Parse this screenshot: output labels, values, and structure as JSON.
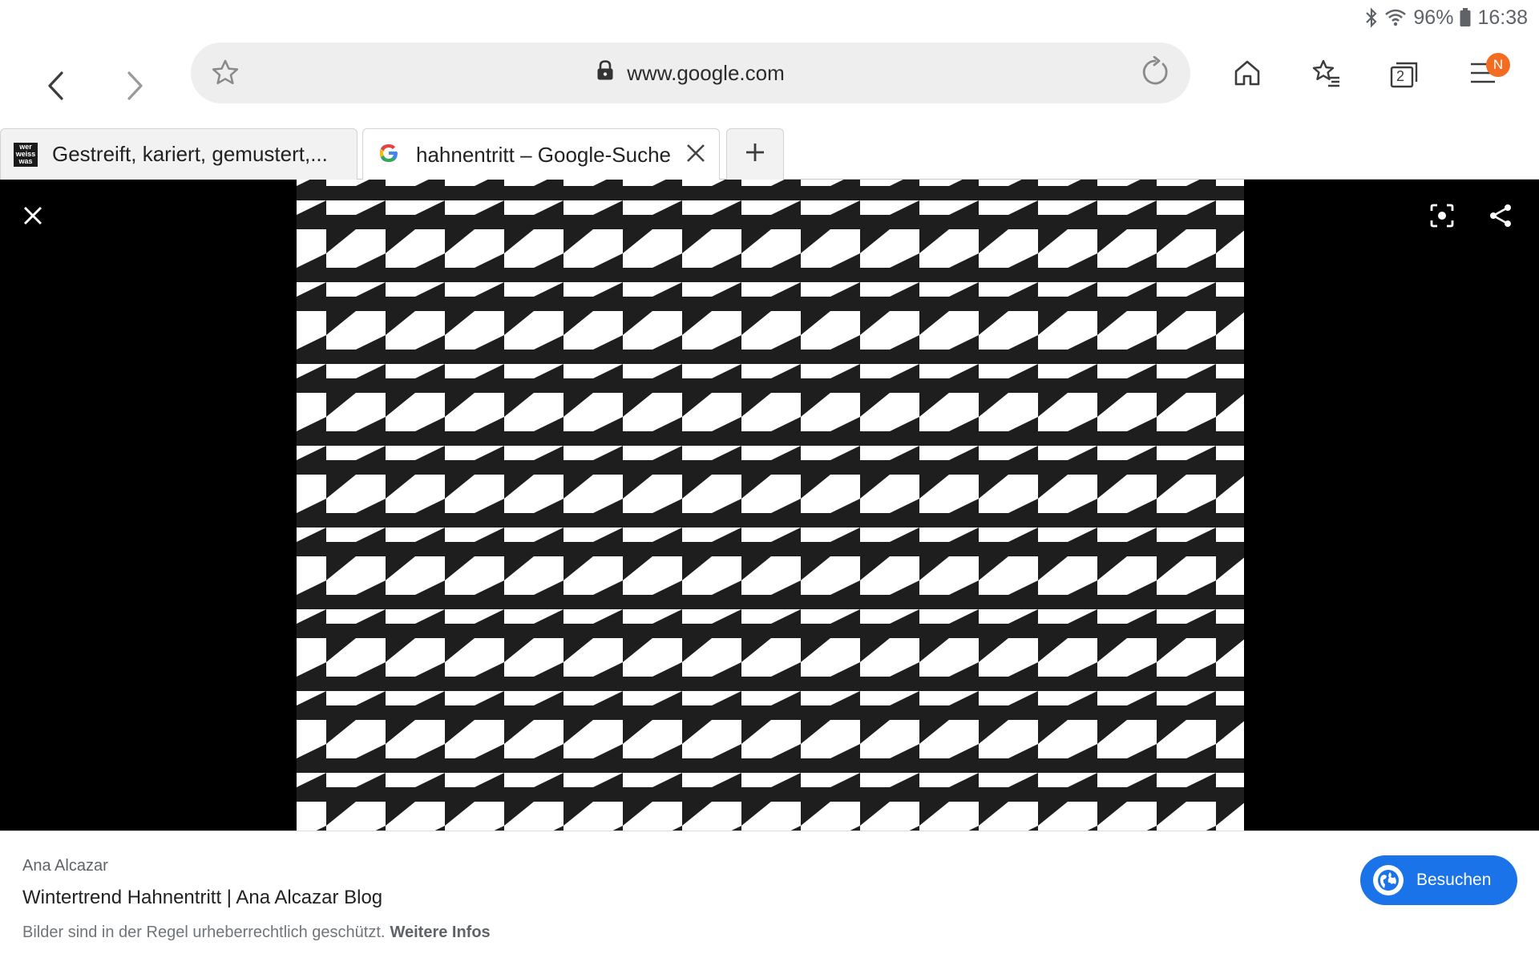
{
  "status_bar": {
    "battery": "96%",
    "time": "16:38",
    "icons": [
      "bluetooth-icon",
      "wifi-icon",
      "battery-icon"
    ]
  },
  "toolbar": {
    "url": "www.google.com",
    "notification_badge": "N",
    "tabs_count": "2",
    "icons": [
      "back-icon",
      "forward-icon",
      "star-icon",
      "lock-icon",
      "reload-icon",
      "home-icon",
      "bookmarks-icon",
      "tabs-icon",
      "menu-icon"
    ]
  },
  "tabs": [
    {
      "title": "Gestreift, kariert, gemustert,...",
      "favicon_text": [
        "wer",
        "weiss",
        "was"
      ]
    },
    {
      "title": "hahnentritt – Google-Suche",
      "favicon": "google-icon"
    }
  ],
  "viewer": {
    "icons": [
      "close-icon",
      "lens-icon",
      "share-icon"
    ],
    "pattern": "houndstooth",
    "colors": {
      "dark": "#1e1e1e",
      "light": "#ffffff",
      "background": "#000000"
    }
  },
  "info": {
    "source": "Ana Alcazar",
    "title": "Wintertrend Hahnentritt | Ana Alcazar Blog",
    "notice": "Bilder sind in der Regel urheberrechtlich geschützt.",
    "notice_link": "Weitere Infos",
    "visit_label": "Besuchen",
    "accent": "#1a73e8"
  }
}
